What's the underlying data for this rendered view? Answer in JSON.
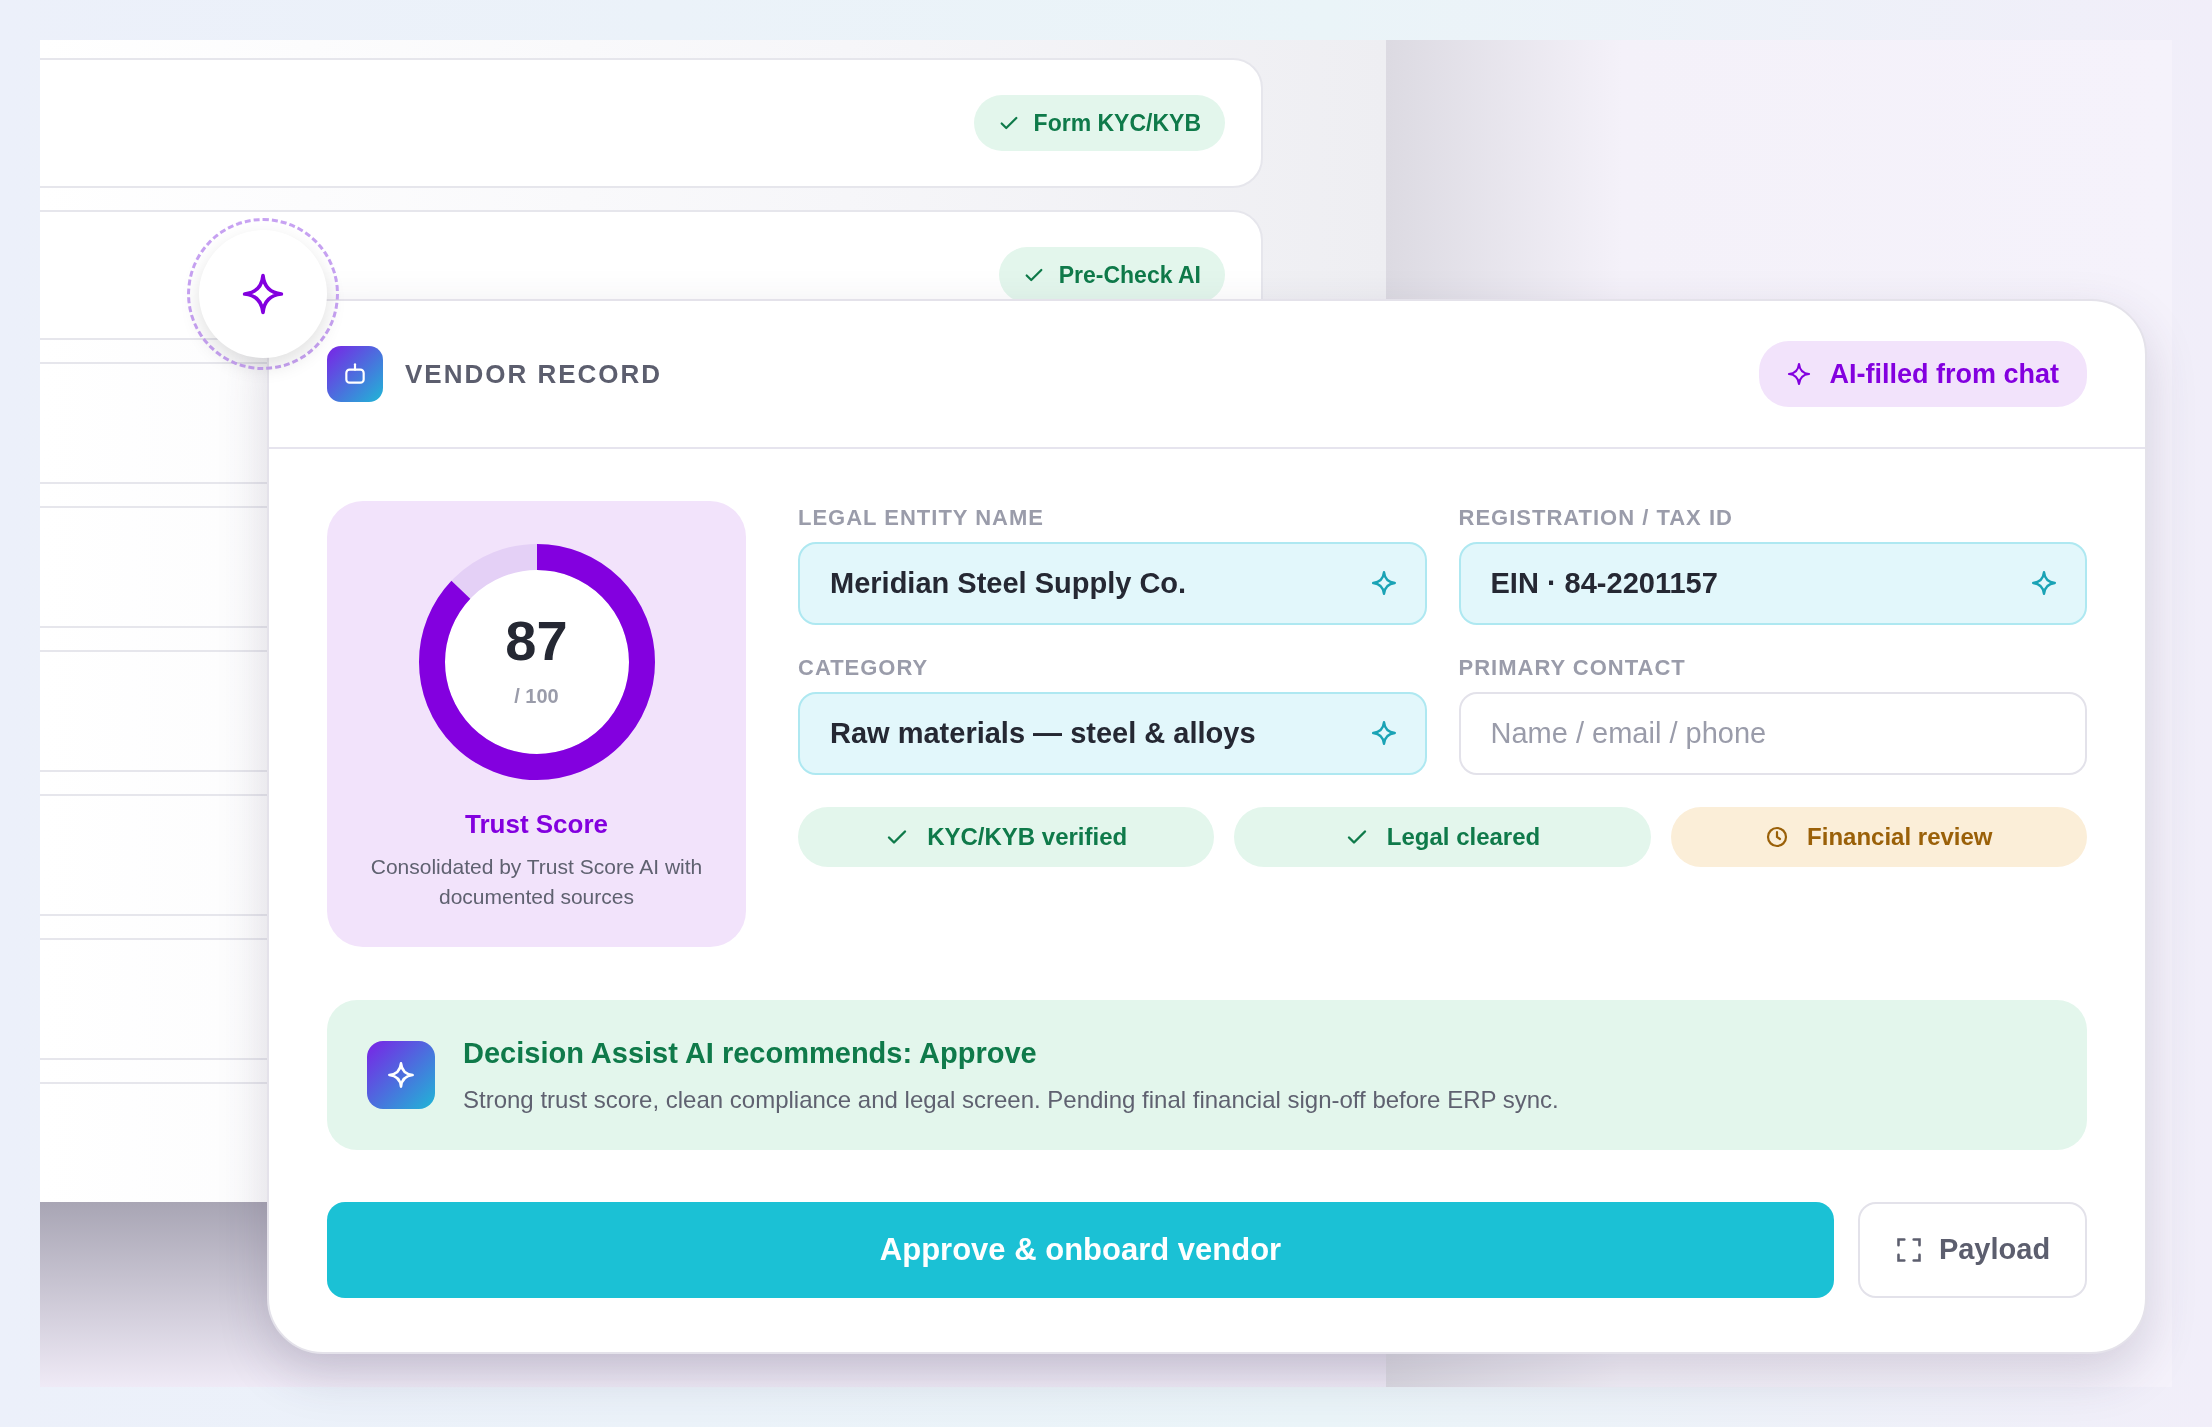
{
  "background_list": {
    "rows": [
      {
        "badge": "Form KYC/KYB",
        "checked": true
      },
      {
        "badge": "Pre-Check AI",
        "checked": true
      }
    ]
  },
  "vendor_record": {
    "title": "VENDOR RECORD",
    "ai_badge": "AI-filled from chat",
    "trust_score": {
      "value": "87",
      "scale": "/ 100",
      "level": 0.87,
      "title": "Trust Score",
      "description": "Consolidated by Trust Score AI with documented sources"
    },
    "fields": [
      {
        "label": "LEGAL ENTITY NAME",
        "value": "Meridian Steel Supply Co.",
        "ai_filled": true
      },
      {
        "label": "REGISTRATION / TAX ID",
        "value": "EIN · 84-2201157",
        "ai_filled": true
      },
      {
        "label": "CATEGORY",
        "value": "Raw materials — steel & alloys",
        "ai_filled": true
      },
      {
        "label": "PRIMARY CONTACT",
        "placeholder": "Name / email / phone",
        "ai_filled": false
      }
    ],
    "statuses": [
      {
        "label": "KYC/KYB verified",
        "kind": "done"
      },
      {
        "label": "Legal cleared",
        "kind": "done"
      },
      {
        "label": "Financial review",
        "kind": "pending"
      }
    ],
    "recommendation": {
      "title": "Decision Assist AI recommends: Approve",
      "text": "Strong trust score, clean compliance and legal screen. Pending final financial sign-off before ERP sync."
    },
    "buttons": {
      "primary": "Approve & onboard vendor",
      "secondary": "Payload"
    }
  }
}
